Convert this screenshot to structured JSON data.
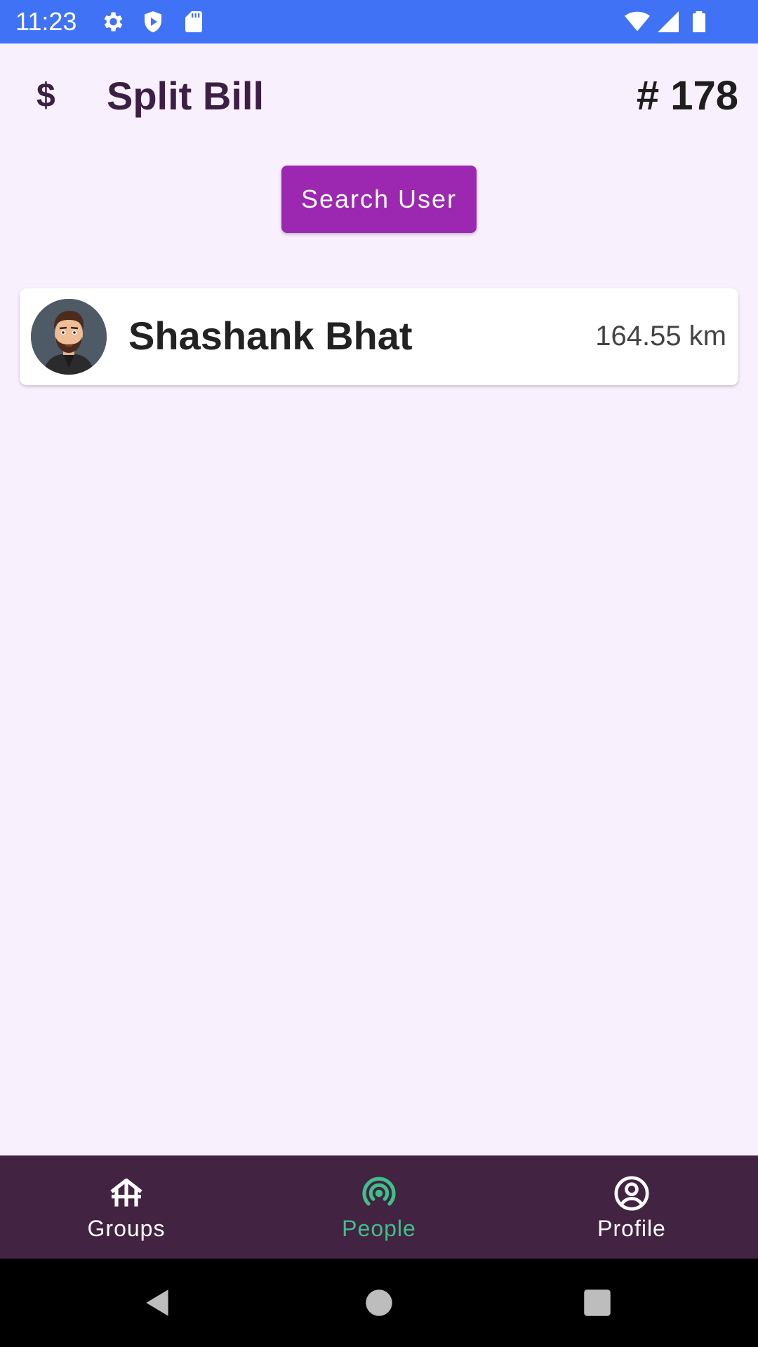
{
  "status_bar": {
    "time": "11:23",
    "icons": [
      "gear-icon",
      "shield-play-icon",
      "sd-card-icon",
      "wifi-icon",
      "signal-icon",
      "battery-icon"
    ],
    "background": "#3f72f5"
  },
  "app_bar": {
    "icon": "$",
    "title": "Split Bill",
    "count": "# 178"
  },
  "search": {
    "button_label": "Search User",
    "button_color": "#9c27b0"
  },
  "users": [
    {
      "name": "Shashank Bhat",
      "distance": "164.55 km",
      "avatar": "avatar-image"
    }
  ],
  "bottom_nav": {
    "background": "#432342",
    "active_color": "#3fbf8a",
    "items": [
      {
        "label": "Groups",
        "icon": "groups-icon",
        "active": false
      },
      {
        "label": "People",
        "icon": "people-radar-icon",
        "active": true
      },
      {
        "label": "Profile",
        "icon": "profile-icon",
        "active": false
      }
    ]
  },
  "system_nav": {
    "buttons": [
      "back-icon",
      "home-icon",
      "recents-icon"
    ]
  }
}
